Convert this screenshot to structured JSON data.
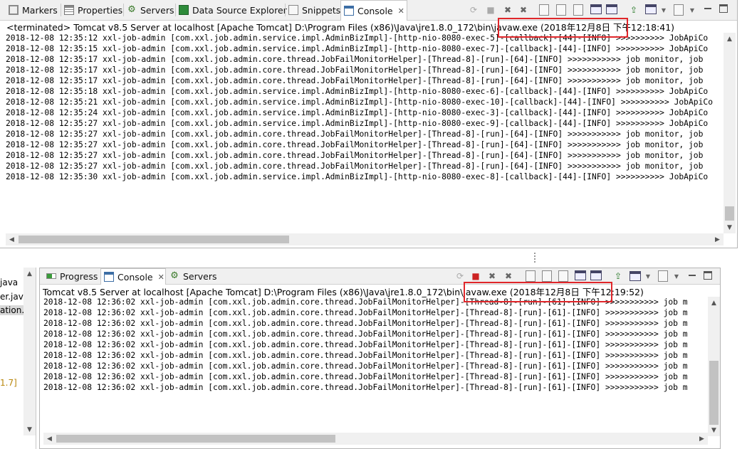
{
  "top": {
    "tabs": [
      {
        "label": "Markers",
        "icon": "markers-icon"
      },
      {
        "label": "Properties",
        "icon": "properties-icon"
      },
      {
        "label": "Servers",
        "icon": "servers-icon"
      },
      {
        "label": "Data Source Explorer",
        "icon": "data-source-icon"
      },
      {
        "label": "Snippets",
        "icon": "snippets-icon"
      },
      {
        "label": "Console",
        "icon": "console-icon",
        "active": true
      }
    ],
    "status_prefix": "<terminated> Tomcat v8.5 Server at localhost [Apache Tomcat] D:\\Program Files (x86)\\Java\\jre1.8.0_172\\bin\\javaw.exe",
    "status_stamp": "(2018年12月8日 下午12:18:41)",
    "lines": [
      "2018-12-08 12:35:12 xxl-job-admin [com.xxl.job.admin.service.impl.AdminBizImpl]-[http-nio-8080-exec-5]-[callback]-[44]-[INFO] >>>>>>>>>> JobApiCo",
      "2018-12-08 12:35:15 xxl-job-admin [com.xxl.job.admin.service.impl.AdminBizImpl]-[http-nio-8080-exec-7]-[callback]-[44]-[INFO] >>>>>>>>>> JobApiCo",
      "2018-12-08 12:35:17 xxl-job-admin [com.xxl.job.admin.core.thread.JobFailMonitorHelper]-[Thread-8]-[run]-[64]-[INFO] >>>>>>>>>>> job monitor, job",
      "2018-12-08 12:35:17 xxl-job-admin [com.xxl.job.admin.core.thread.JobFailMonitorHelper]-[Thread-8]-[run]-[64]-[INFO] >>>>>>>>>>> job monitor, job",
      "2018-12-08 12:35:17 xxl-job-admin [com.xxl.job.admin.core.thread.JobFailMonitorHelper]-[Thread-8]-[run]-[64]-[INFO] >>>>>>>>>>> job monitor, job",
      "2018-12-08 12:35:18 xxl-job-admin [com.xxl.job.admin.service.impl.AdminBizImpl]-[http-nio-8080-exec-6]-[callback]-[44]-[INFO] >>>>>>>>>> JobApiCo",
      "2018-12-08 12:35:21 xxl-job-admin [com.xxl.job.admin.service.impl.AdminBizImpl]-[http-nio-8080-exec-10]-[callback]-[44]-[INFO] >>>>>>>>>> JobApiCo",
      "2018-12-08 12:35:24 xxl-job-admin [com.xxl.job.admin.service.impl.AdminBizImpl]-[http-nio-8080-exec-3]-[callback]-[44]-[INFO] >>>>>>>>>> JobApiCo",
      "2018-12-08 12:35:27 xxl-job-admin [com.xxl.job.admin.service.impl.AdminBizImpl]-[http-nio-8080-exec-9]-[callback]-[44]-[INFO] >>>>>>>>>> JobApiCo",
      "2018-12-08 12:35:27 xxl-job-admin [com.xxl.job.admin.core.thread.JobFailMonitorHelper]-[Thread-8]-[run]-[64]-[INFO] >>>>>>>>>>> job monitor, job",
      "2018-12-08 12:35:27 xxl-job-admin [com.xxl.job.admin.core.thread.JobFailMonitorHelper]-[Thread-8]-[run]-[64]-[INFO] >>>>>>>>>>> job monitor, job",
      "2018-12-08 12:35:27 xxl-job-admin [com.xxl.job.admin.core.thread.JobFailMonitorHelper]-[Thread-8]-[run]-[64]-[INFO] >>>>>>>>>>> job monitor, job",
      "2018-12-08 12:35:27 xxl-job-admin [com.xxl.job.admin.core.thread.JobFailMonitorHelper]-[Thread-8]-[run]-[64]-[INFO] >>>>>>>>>>> job monitor, job",
      "2018-12-08 12:35:30 xxl-job-admin [com.xxl.job.admin.service.impl.AdminBizImpl]-[http-nio-8080-exec-8]-[callback]-[44]-[INFO] >>>>>>>>>> JobApiCo"
    ]
  },
  "bottom": {
    "tabs": [
      {
        "label": "Progress",
        "icon": "progress-icon"
      },
      {
        "label": "Console",
        "icon": "console-icon",
        "active": true
      },
      {
        "label": "Servers",
        "icon": "servers-icon"
      }
    ],
    "status_prefix": "Tomcat v8.5 Server at localhost [Apache Tomcat] D:\\Program Files (x86)\\Java\\jre1.8.0_172\\bin\\javaw.exe",
    "status_stamp": "(2018年12月8日 下午12:19:52)",
    "lines": [
      "2018-12-08 12:36:02 xxl-job-admin [com.xxl.job.admin.core.thread.JobFailMonitorHelper]-[Thread-8]-[run]-[61]-[INFO] >>>>>>>>>>> job m",
      "2018-12-08 12:36:02 xxl-job-admin [com.xxl.job.admin.core.thread.JobFailMonitorHelper]-[Thread-8]-[run]-[61]-[INFO] >>>>>>>>>>> job m",
      "2018-12-08 12:36:02 xxl-job-admin [com.xxl.job.admin.core.thread.JobFailMonitorHelper]-[Thread-8]-[run]-[61]-[INFO] >>>>>>>>>>> job m",
      "2018-12-08 12:36:02 xxl-job-admin [com.xxl.job.admin.core.thread.JobFailMonitorHelper]-[Thread-8]-[run]-[61]-[INFO] >>>>>>>>>>> job m",
      "2018-12-08 12:36:02 xxl-job-admin [com.xxl.job.admin.core.thread.JobFailMonitorHelper]-[Thread-8]-[run]-[61]-[INFO] >>>>>>>>>>> job m",
      "2018-12-08 12:36:02 xxl-job-admin [com.xxl.job.admin.core.thread.JobFailMonitorHelper]-[Thread-8]-[run]-[61]-[INFO] >>>>>>>>>>> job m",
      "2018-12-08 12:36:02 xxl-job-admin [com.xxl.job.admin.core.thread.JobFailMonitorHelper]-[Thread-8]-[run]-[61]-[INFO] >>>>>>>>>>> job m",
      "2018-12-08 12:36:02 xxl-job-admin [com.xxl.job.admin.core.thread.JobFailMonitorHelper]-[Thread-8]-[run]-[61]-[INFO] >>>>>>>>>>> job m",
      "2018-12-08 12:36:02 xxl-job-admin [com.xxl.job.admin.core.thread.JobFailMonitorHelper]-[Thread-8]-[run]-[61]-[INFO] >>>>>>>>>>> job m"
    ]
  },
  "left_fragment": [
    "java",
    "er.jav",
    "ation.j",
    "1.7]"
  ],
  "colors": {
    "highlight": "#e0262a",
    "tab_bg": "#f0f0f0",
    "version_label": "#b8860b"
  }
}
